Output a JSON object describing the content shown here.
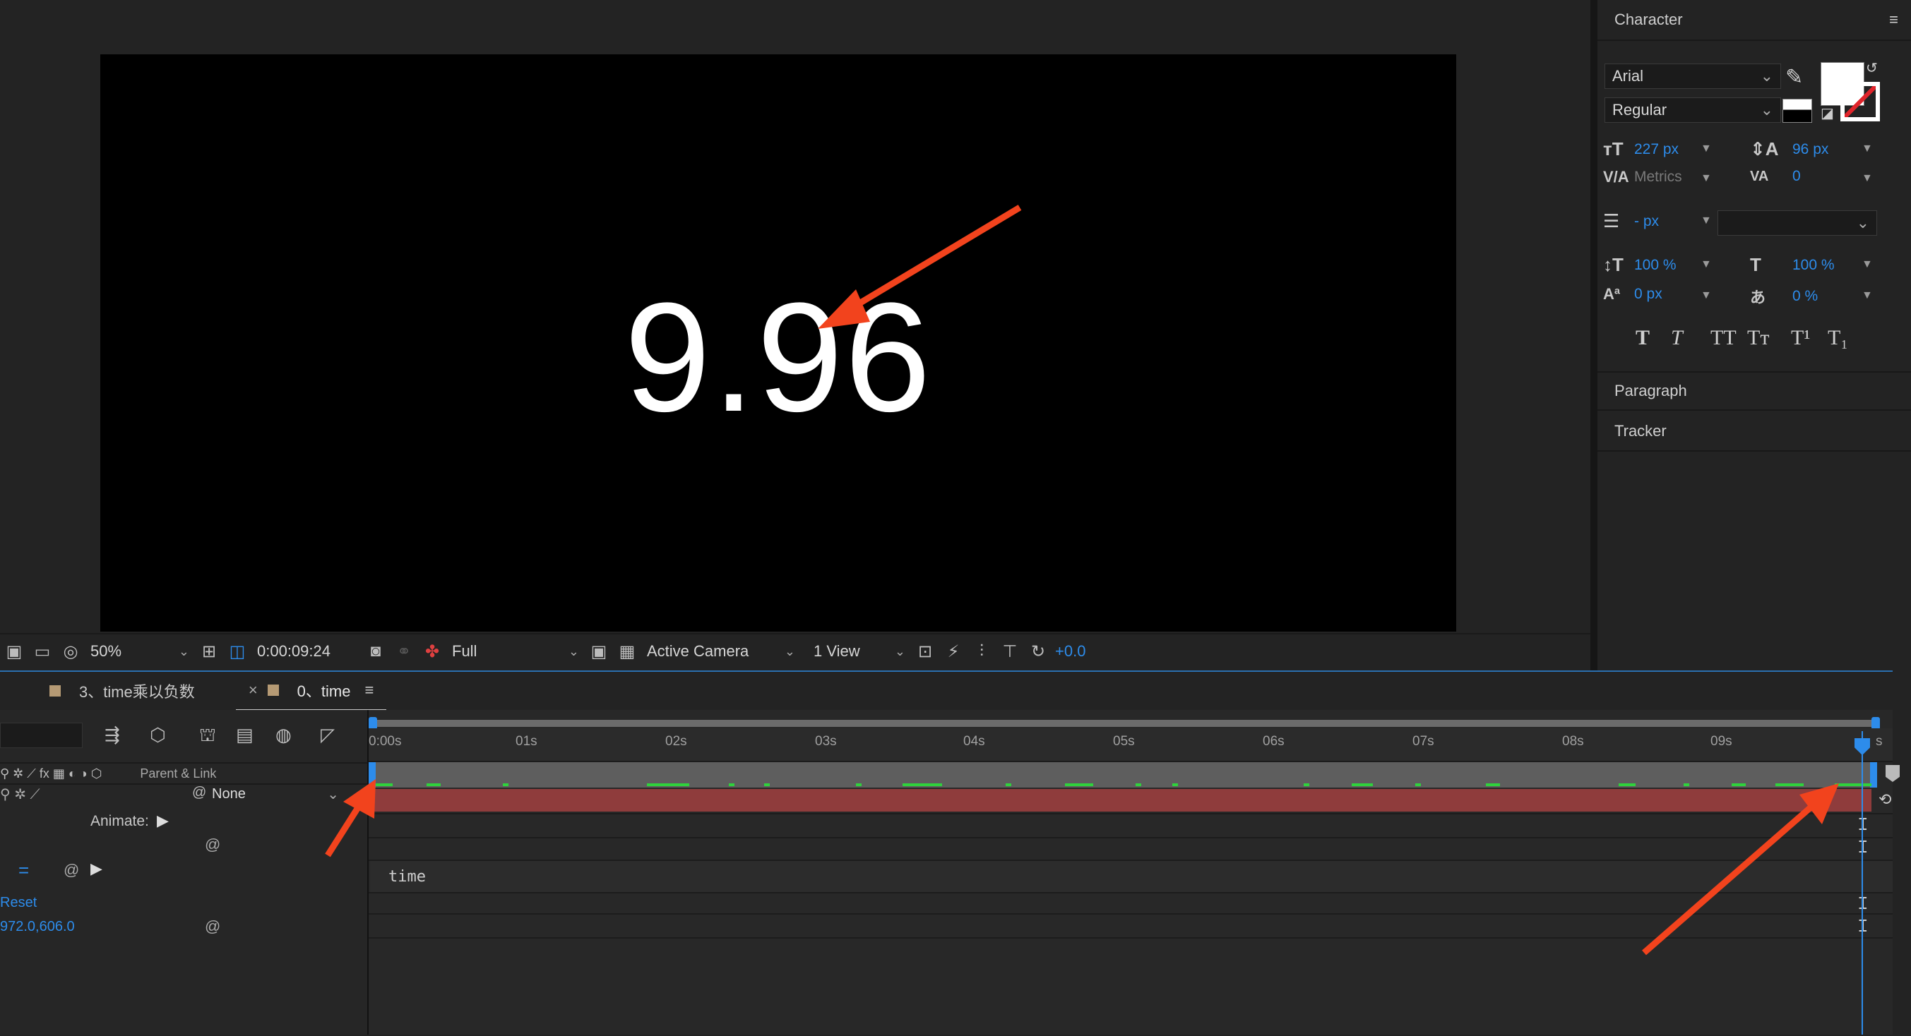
{
  "viewer": {
    "display_value": "9.96",
    "toolbar": {
      "magnification": "50%",
      "timecode": "0:00:09:24",
      "resolution": "Full",
      "camera": "Active Camera",
      "views": "1 View",
      "exposure": "+0.0"
    }
  },
  "character_panel": {
    "title": "Character",
    "font_family": "Arial",
    "font_style": "Regular",
    "font_size": "227 px",
    "leading": "96 px",
    "kerning": "Metrics",
    "tracking": "0",
    "stroke_width": "- px",
    "vertical_scale": "100 %",
    "horizontal_scale": "100 %",
    "baseline_shift": "0 px",
    "tsume": "0 %",
    "style_buttons": [
      "T",
      "T",
      "TT",
      "Tт",
      "T¹",
      "T₁"
    ],
    "fill_color": "#ffffff"
  },
  "paragraph_panel": {
    "title": "Paragraph"
  },
  "tracker_panel": {
    "title": "Tracker"
  },
  "timeline": {
    "tabs": [
      {
        "label": "3、time乘以负数",
        "color": "#b59a74"
      },
      {
        "label": "0、time",
        "color": "#b59a74"
      }
    ],
    "ruler": [
      "0:00s",
      "01s",
      "02s",
      "03s",
      "04s",
      "05s",
      "06s",
      "07s",
      "08s",
      "09s",
      "s"
    ],
    "columns": {
      "parent_link": "Parent & Link"
    },
    "layer": {
      "parent": "None"
    },
    "animate_label": "Animate:",
    "expression_text": "time",
    "reset_label": "Reset",
    "position_value": "972.0,606.0"
  },
  "colors": {
    "accent": "#2d8ceb",
    "annotation_arrow": "#f2431d",
    "layer_bar": "#8f3c3c",
    "cache_bar": "#2fd23c"
  }
}
